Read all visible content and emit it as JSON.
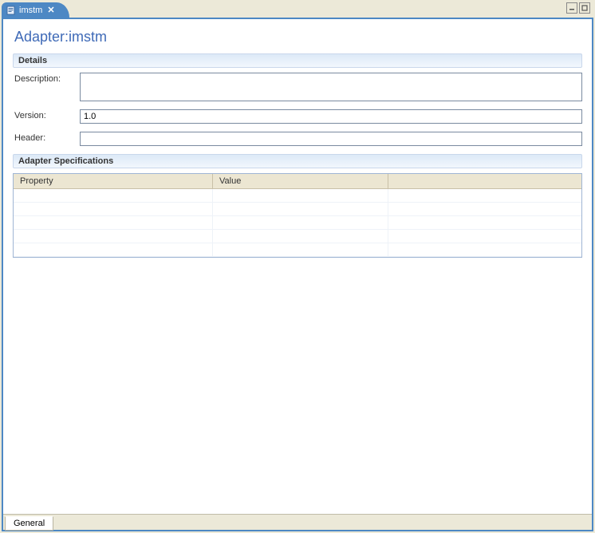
{
  "tab": {
    "label": "imstm"
  },
  "page": {
    "title": "Adapter:imstm"
  },
  "sections": {
    "details": "Details",
    "specs": "Adapter Specifications"
  },
  "form": {
    "description": {
      "label": "Description:",
      "value": ""
    },
    "version": {
      "label": "Version:",
      "value": "1.0"
    },
    "header": {
      "label": "Header:",
      "value": ""
    }
  },
  "table": {
    "columns": {
      "property": "Property",
      "value": "Value"
    },
    "rows": [
      {
        "property": "",
        "value": ""
      },
      {
        "property": "",
        "value": ""
      },
      {
        "property": "",
        "value": ""
      },
      {
        "property": "",
        "value": ""
      },
      {
        "property": "",
        "value": ""
      }
    ]
  },
  "bottomTabs": {
    "general": "General"
  }
}
